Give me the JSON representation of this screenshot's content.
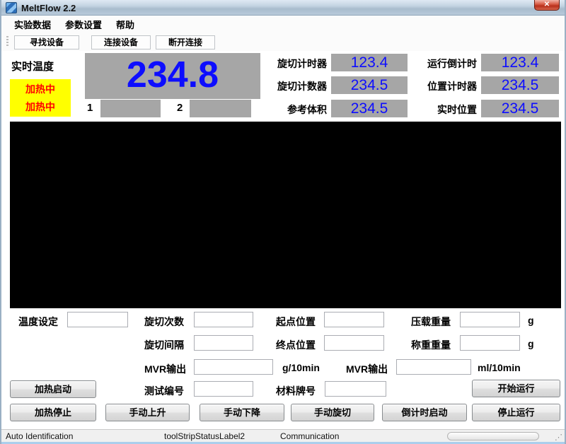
{
  "window": {
    "title": "MeltFlow 2.2",
    "close_glyph": "✕"
  },
  "menu": {
    "items": [
      {
        "label": "实验数据"
      },
      {
        "label": "参数设置"
      },
      {
        "label": "帮助"
      }
    ]
  },
  "toolbar": {
    "buttons": [
      {
        "label": "寻找设备"
      },
      {
        "label": "连接设备"
      },
      {
        "label": "断开连接"
      }
    ]
  },
  "status_panel": {
    "temp_label": "实时温度",
    "heating_status": [
      "加热中",
      "加热中"
    ],
    "temperature_value": "234.8",
    "channel1_label": "1",
    "channel2_label": "2",
    "meters": [
      {
        "label": "旋切计时器",
        "value": "123.4"
      },
      {
        "label": "运行倒计时",
        "value": "123.4"
      },
      {
        "label": "旋切计数器",
        "value": "234.5"
      },
      {
        "label": "位置计时器",
        "value": "234.5"
      },
      {
        "label": "参考体积",
        "value": "234.5"
      },
      {
        "label": "实时位置",
        "value": "234.5"
      }
    ],
    "colors": {
      "value_blue": "#0d0dff",
      "box_gray": "#a6a6a6",
      "alert_text": "#ff0000",
      "alert_bg": "#ffff00",
      "panel_black": "#000000"
    }
  },
  "form": {
    "temp_set_label": "温度设定",
    "cut_count_label": "旋切次数",
    "cut_interval_label": "旋切间隔",
    "mvr_g_label": "MVR输出",
    "mvr_g_unit": "g/10min",
    "mvr_ml_label": "MVR输出",
    "mvr_ml_unit": "ml/10min",
    "start_pos_label": "起点位置",
    "end_pos_label": "终点位置",
    "load_weight_label": "压载重量",
    "weigh_weight_label": "称重重量",
    "gram_unit1": "g",
    "gram_unit2": "g",
    "test_no_label": "测试编号",
    "material_label": "材料牌号"
  },
  "buttons": {
    "heat_start": "加热启动",
    "heat_stop": "加热停止",
    "manual_up": "手动上升",
    "manual_down": "手动下降",
    "manual_cut": "手动旋切",
    "countdown_start": "倒计时启动",
    "run_start": "开始运行",
    "run_stop": "停止运行"
  },
  "statusbar": {
    "left": "Auto Identification",
    "center": "toolStripStatusLabel2",
    "right": "Communication",
    "grip_glyph": "⋰"
  }
}
